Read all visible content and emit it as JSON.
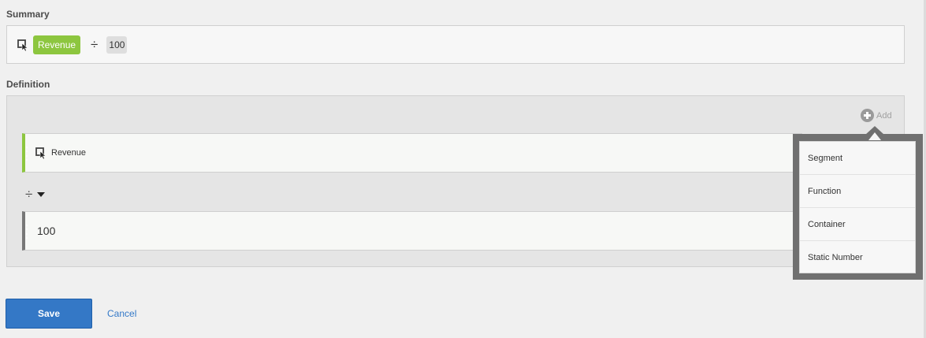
{
  "summary": {
    "label": "Summary",
    "metric_name": "Revenue",
    "operator_symbol": "÷",
    "static_value": "100"
  },
  "definition": {
    "label": "Definition",
    "add_label": "Add",
    "rows": [
      {
        "type": "metric",
        "label": "Revenue"
      },
      {
        "type": "static-number",
        "label": "100"
      }
    ],
    "operator_symbol": "÷"
  },
  "add_menu": {
    "items": [
      "Segment",
      "Function",
      "Container",
      "Static Number"
    ]
  },
  "footer": {
    "save_label": "Save",
    "cancel_label": "Cancel"
  },
  "colors": {
    "metric_accent": "#8dc63f",
    "primary_button": "#3478c6",
    "link": "#3479c8"
  },
  "icons": {
    "metric": "metric-cursor-icon",
    "add": "plus-circle-icon",
    "operator_caret": "caret-down-icon"
  }
}
